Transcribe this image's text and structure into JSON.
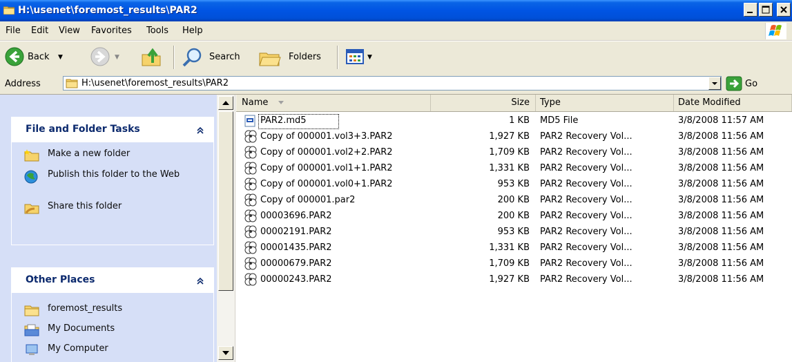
{
  "window": {
    "title": "H:\\usenet\\foremost_results\\PAR2"
  },
  "menu": {
    "items": [
      {
        "label": "File"
      },
      {
        "label": "Edit"
      },
      {
        "label": "View"
      },
      {
        "label": "Favorites"
      },
      {
        "label": "Tools"
      },
      {
        "label": "Help"
      }
    ]
  },
  "toolbar": {
    "back_label": "Back",
    "search_label": "Search",
    "folders_label": "Folders"
  },
  "address": {
    "label": "Address",
    "value": "H:\\usenet\\foremost_results\\PAR2",
    "go_label": "Go"
  },
  "tasks": {
    "file_folder_title": "File and Folder Tasks",
    "file_folder_items": [
      {
        "label": "Make a new folder",
        "icon": "new-folder-icon"
      },
      {
        "label": "Publish this folder to the Web",
        "icon": "publish-web-icon"
      },
      {
        "label": "Share this folder",
        "icon": "share-folder-icon"
      }
    ],
    "other_places_title": "Other Places",
    "other_places_items": [
      {
        "label": "foremost_results",
        "icon": "folder-icon"
      },
      {
        "label": "My Documents",
        "icon": "my-documents-icon"
      },
      {
        "label": "My Computer",
        "icon": "my-computer-icon"
      }
    ]
  },
  "columns": {
    "name": "Name",
    "size": "Size",
    "type": "Type",
    "date": "Date Modified"
  },
  "files": [
    {
      "name": "PAR2.md5",
      "size": "1 KB",
      "type": "MD5 File",
      "date": "3/8/2008 11:57 AM",
      "icon": "md5-file-icon"
    },
    {
      "name": "Copy of 000001.vol3+3.PAR2",
      "size": "1,927 KB",
      "type": "PAR2 Recovery Vol...",
      "date": "3/8/2008 11:56 AM",
      "icon": "par2-file-icon"
    },
    {
      "name": "Copy of 000001.vol2+2.PAR2",
      "size": "1,709 KB",
      "type": "PAR2 Recovery Vol...",
      "date": "3/8/2008 11:56 AM",
      "icon": "par2-file-icon"
    },
    {
      "name": "Copy of 000001.vol1+1.PAR2",
      "size": "1,331 KB",
      "type": "PAR2 Recovery Vol...",
      "date": "3/8/2008 11:56 AM",
      "icon": "par2-file-icon"
    },
    {
      "name": "Copy of 000001.vol0+1.PAR2",
      "size": "953 KB",
      "type": "PAR2 Recovery Vol...",
      "date": "3/8/2008 11:56 AM",
      "icon": "par2-file-icon"
    },
    {
      "name": "Copy of 000001.par2",
      "size": "200 KB",
      "type": "PAR2 Recovery Vol...",
      "date": "3/8/2008 11:56 AM",
      "icon": "par2-file-icon"
    },
    {
      "name": "00003696.PAR2",
      "size": "200 KB",
      "type": "PAR2 Recovery Vol...",
      "date": "3/8/2008 11:56 AM",
      "icon": "par2-file-icon"
    },
    {
      "name": "00002191.PAR2",
      "size": "953 KB",
      "type": "PAR2 Recovery Vol...",
      "date": "3/8/2008 11:56 AM",
      "icon": "par2-file-icon"
    },
    {
      "name": "00001435.PAR2",
      "size": "1,331 KB",
      "type": "PAR2 Recovery Vol...",
      "date": "3/8/2008 11:56 AM",
      "icon": "par2-file-icon"
    },
    {
      "name": "00000679.PAR2",
      "size": "1,709 KB",
      "type": "PAR2 Recovery Vol...",
      "date": "3/8/2008 11:56 AM",
      "icon": "par2-file-icon"
    },
    {
      "name": "00000243.PAR2",
      "size": "1,927 KB",
      "type": "PAR2 Recovery Vol...",
      "date": "3/8/2008 11:56 AM",
      "icon": "par2-file-icon"
    }
  ],
  "colors": {
    "titlebar": "#0054e3",
    "task_header_text": "#215dc6",
    "task_pane_bg": "#d6dff7",
    "window_bg": "#ece9d8"
  }
}
